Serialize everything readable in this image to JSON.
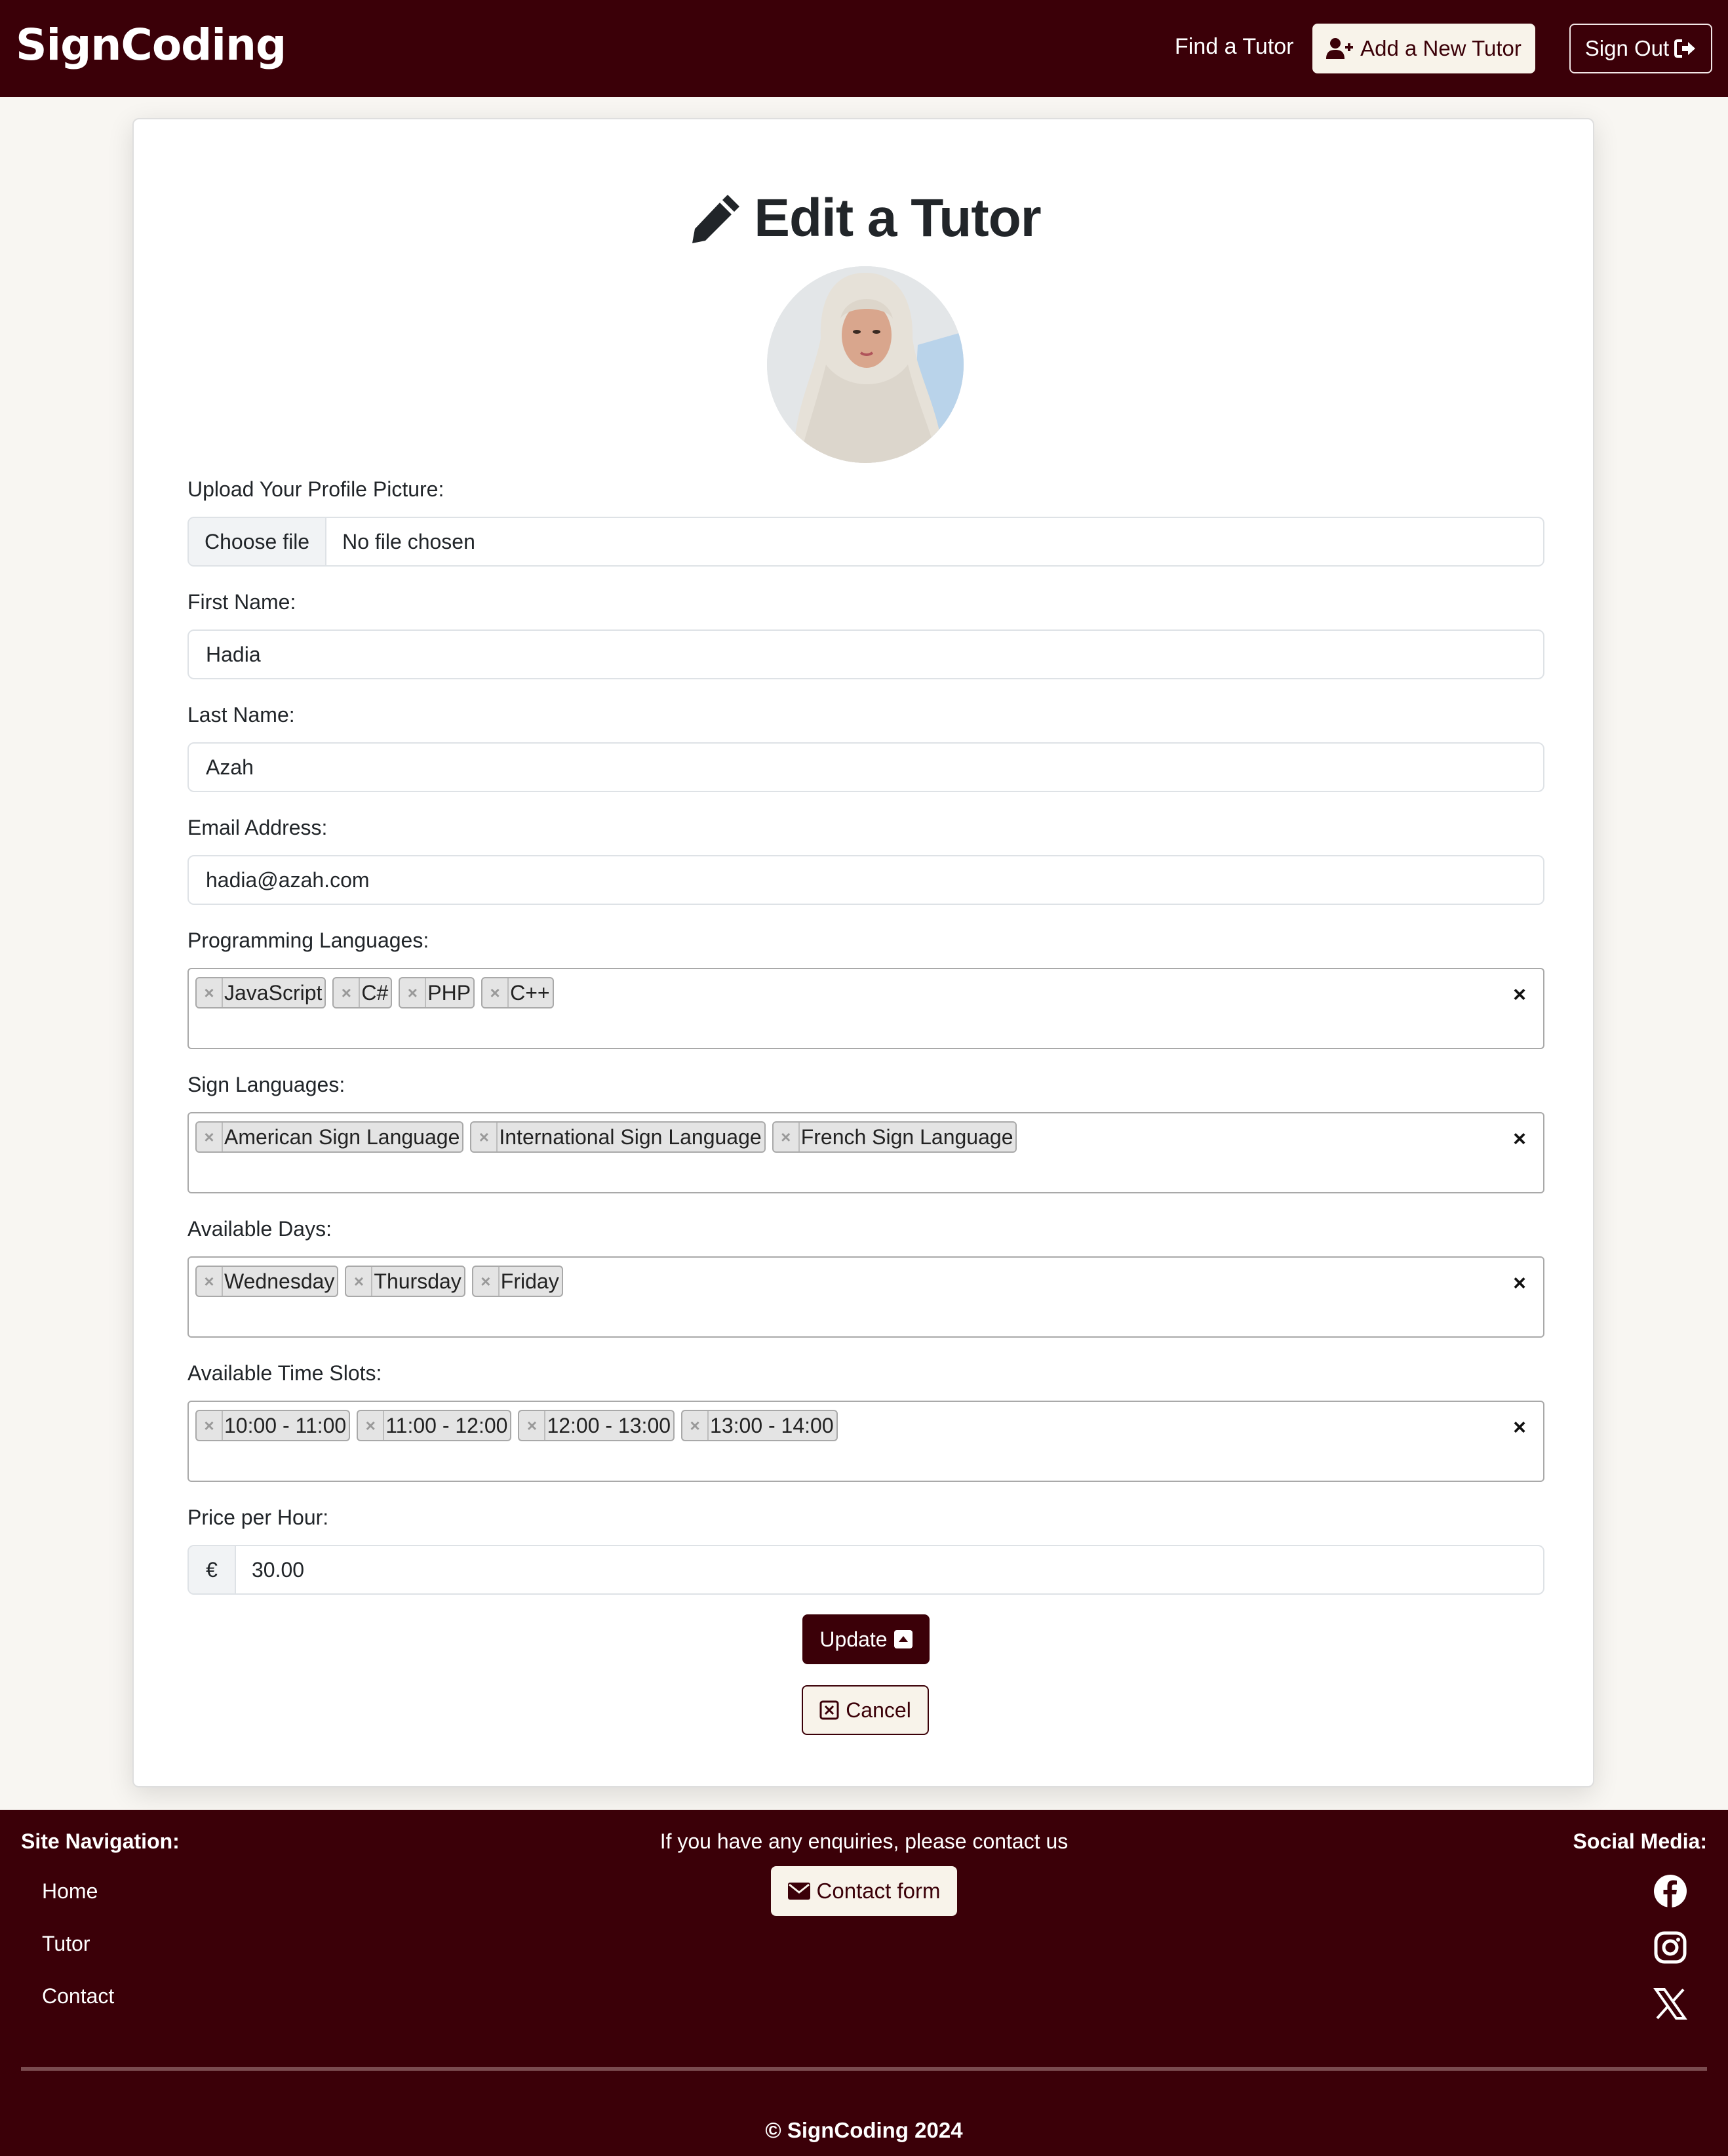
{
  "header": {
    "brand": "SignCoding",
    "find_tutor": "Find a Tutor",
    "add_tutor": "Add a New Tutor",
    "sign_out": "Sign Out"
  },
  "form": {
    "title": "Edit a Tutor",
    "profile_picture": {
      "label": "Upload Your Profile Picture:",
      "button": "Choose file",
      "status": "No file chosen"
    },
    "first_name": {
      "label": "First Name:",
      "value": "Hadia"
    },
    "last_name": {
      "label": "Last Name:",
      "value": "Azah"
    },
    "email": {
      "label": "Email Address:",
      "value": "hadia@azah.com"
    },
    "programming_languages": {
      "label": "Programming Languages:",
      "selected": [
        "JavaScript",
        "C#",
        "PHP",
        "C++"
      ]
    },
    "sign_languages": {
      "label": "Sign Languages:",
      "selected": [
        "American Sign Language",
        "International Sign Language",
        "French Sign Language"
      ]
    },
    "available_days": {
      "label": "Available Days:",
      "selected": [
        "Wednesday",
        "Thursday",
        "Friday"
      ]
    },
    "time_slots": {
      "label": "Available Time Slots:",
      "selected": [
        "10:00 - 11:00",
        "11:00 - 12:00",
        "12:00 - 13:00",
        "13:00 - 14:00"
      ]
    },
    "price": {
      "label": "Price per Hour:",
      "currency": "€",
      "value": "30.00"
    },
    "tag_remove": "×",
    "clear_all": "×",
    "update_button": "Update",
    "cancel_button": "Cancel"
  },
  "footer": {
    "nav_heading": "Site Navigation:",
    "nav_links": [
      "Home",
      "Tutor",
      "Contact"
    ],
    "enquiry_text": "If you have any enquiries, please contact us",
    "contact_button": "Contact form",
    "social_heading": "Social Media:",
    "social_icons": [
      "facebook-icon",
      "instagram-icon",
      "x-icon"
    ],
    "copyright": "© SignCoding 2024"
  },
  "colors": {
    "brand_dark": "#3b0008",
    "cream": "#f8f3ea",
    "page_bg": "#f8f6f2"
  }
}
